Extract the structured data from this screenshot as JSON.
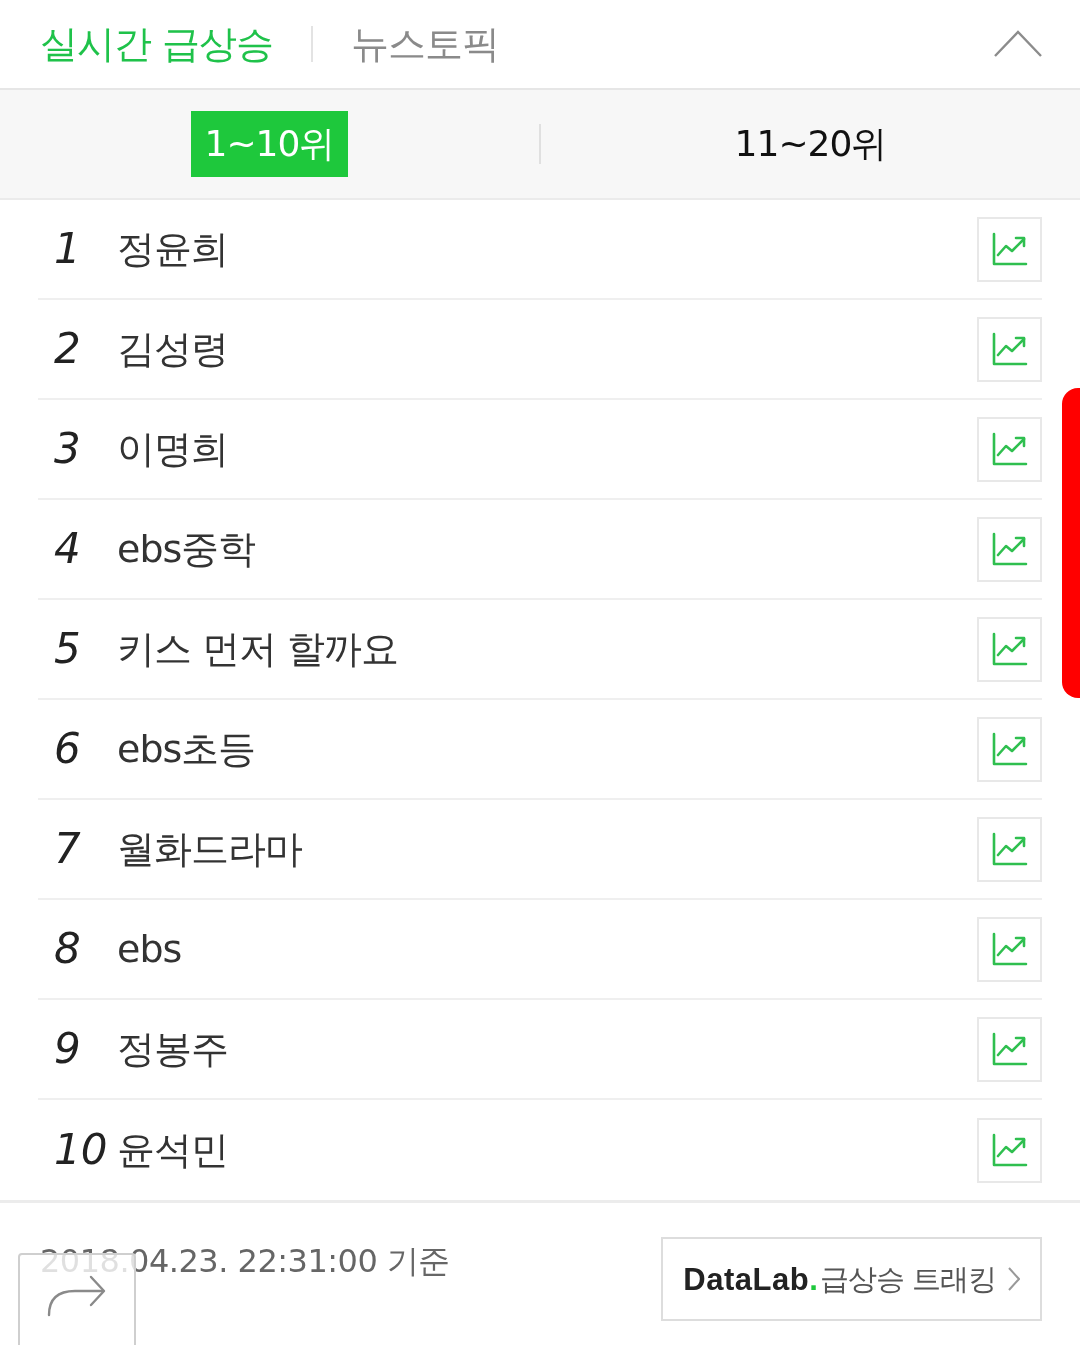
{
  "header": {
    "tabs": [
      {
        "label": "실시간 급상승",
        "selected": true
      },
      {
        "label": "뉴스토픽",
        "selected": false
      }
    ],
    "expanded": true
  },
  "range_tabs": [
    {
      "label": "1~10위",
      "selected": true
    },
    {
      "label": "11~20위",
      "selected": false
    }
  ],
  "rows": [
    {
      "rank": "1",
      "keyword": "정윤희"
    },
    {
      "rank": "2",
      "keyword": "김성령"
    },
    {
      "rank": "3",
      "keyword": "이명희"
    },
    {
      "rank": "4",
      "keyword": "ebs중학"
    },
    {
      "rank": "5",
      "keyword": "키스 먼저 할까요"
    },
    {
      "rank": "6",
      "keyword": "ebs초등"
    },
    {
      "rank": "7",
      "keyword": "월화드라마"
    },
    {
      "rank": "8",
      "keyword": "ebs"
    },
    {
      "rank": "9",
      "keyword": "정봉주"
    },
    {
      "rank": "10",
      "keyword": "윤석민"
    }
  ],
  "footer": {
    "timestamp": "2018.04.23. 22:31:00 기준",
    "datalab_button": {
      "brand": "DataLab",
      "brand_dot": ".",
      "label": "급상승 트래킹"
    }
  }
}
